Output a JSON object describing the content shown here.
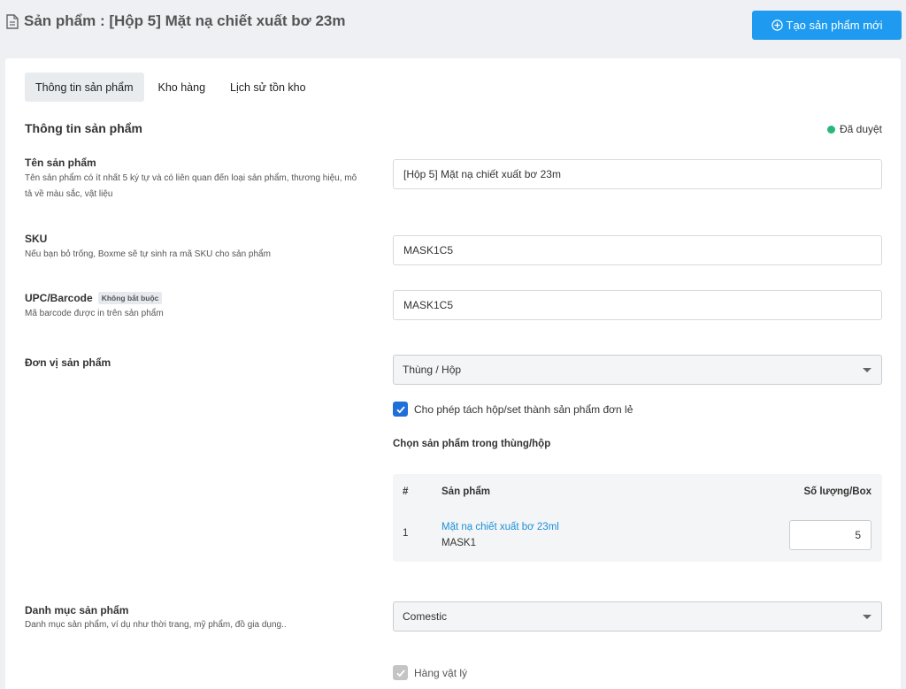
{
  "header": {
    "title": "Sản phẩm : [Hộp 5] Mặt nạ chiết xuất bơ 23m",
    "create_button": "Tạo sản phẩm mới"
  },
  "tabs": [
    {
      "label": "Thông tin sản phẩm",
      "active": true
    },
    {
      "label": "Kho hàng",
      "active": false
    },
    {
      "label": "Lịch sử tồn kho",
      "active": false
    }
  ],
  "section": {
    "title": "Thông tin sản phẩm",
    "status": "Đã duyệt",
    "status_color": "#28b779"
  },
  "fields": {
    "name": {
      "label": "Tên sản phẩm",
      "hint": "Tên sản phẩm có ít nhất 5 ký tự và có liên quan đến loại sản phẩm, thương hiệu, mô tả về màu sắc, vật liệu",
      "value": "[Hộp 5] Mặt nạ chiết xuất bơ 23m"
    },
    "sku": {
      "label": "SKU",
      "hint": "Nếu bạn bỏ trống, Boxme sẽ tự sinh ra mã SKU cho sản phẩm",
      "value": "MASK1C5"
    },
    "barcode": {
      "label": "UPC/Barcode",
      "badge": "Không bắt buộc",
      "hint": "Mã barcode được in trên sản phẩm",
      "value": "MASK1C5"
    },
    "unit": {
      "label": "Đơn vị sản phẩm",
      "value": "Thùng / Hộp"
    },
    "split_checkbox": {
      "label": "Cho phép tách hộp/set thành sản phẩm đơn lẻ",
      "checked": true
    },
    "category": {
      "label": "Danh mục sản phẩm",
      "hint": "Danh mục sản phẩm, ví dụ như thời trang, mỹ phẩm, đồ gia dụng..",
      "value": "Comestic"
    },
    "physical_checkbox": {
      "label": "Hàng vật lý",
      "checked": true,
      "disabled": true
    }
  },
  "box_products": {
    "title": "Chọn sản phẩm trong thùng/hộp",
    "columns": [
      "#",
      "Sản phẩm",
      "Số lượng/Box"
    ],
    "rows": [
      {
        "index": "1",
        "name": "Mặt nạ chiết xuất bơ 23ml",
        "sku": "MASK1",
        "qty": "5"
      }
    ]
  },
  "colors": {
    "accent": "#1e9bf0",
    "link": "#1e8fd9",
    "checkbox": "#1e6fd9"
  }
}
